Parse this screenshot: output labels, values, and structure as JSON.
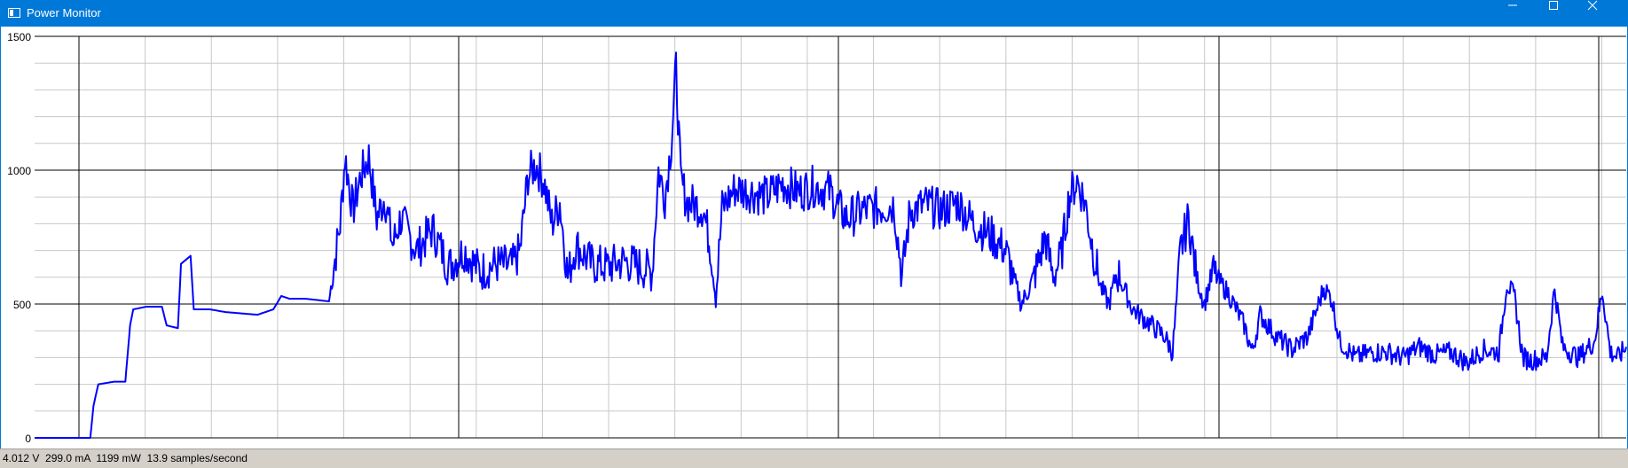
{
  "window": {
    "title": "Power Monitor",
    "minimize_icon": "minimize-icon",
    "maximize_icon": "maximize-icon",
    "close_icon": "close-icon",
    "accent_color": "#0078d7"
  },
  "status": {
    "text": "4.012 V  299.0 mA  1199 mW  13.9 samples/second"
  },
  "chart_data": {
    "type": "line",
    "title": "",
    "xlabel": "",
    "ylabel": "",
    "ylim": [
      0,
      1500
    ],
    "yticks": [
      0,
      500,
      1000,
      1500
    ],
    "grid": true,
    "line_color": "#0000ff",
    "x_range": [
      0,
      1000
    ],
    "series": [
      {
        "name": "",
        "points": [
          [
            0,
            0
          ],
          [
            30,
            0
          ],
          [
            35,
            0
          ],
          [
            37,
            120
          ],
          [
            40,
            200
          ],
          [
            50,
            210
          ],
          [
            57,
            210
          ],
          [
            60,
            420
          ],
          [
            62,
            480
          ],
          [
            70,
            490
          ],
          [
            80,
            490
          ],
          [
            83,
            420
          ],
          [
            90,
            410
          ],
          [
            92,
            650
          ],
          [
            98,
            680
          ],
          [
            100,
            480
          ],
          [
            110,
            480
          ],
          [
            120,
            470
          ],
          [
            140,
            460
          ],
          [
            150,
            480
          ],
          [
            155,
            530
          ],
          [
            160,
            520
          ],
          [
            170,
            520
          ],
          [
            185,
            510
          ],
          [
            188,
            640
          ],
          [
            192,
            800
          ],
          [
            195,
            1050
          ],
          [
            200,
            850
          ],
          [
            205,
            980
          ],
          [
            210,
            1050
          ],
          [
            215,
            820
          ],
          [
            220,
            900
          ],
          [
            225,
            720
          ],
          [
            230,
            820
          ],
          [
            240,
            700
          ],
          [
            250,
            780
          ],
          [
            260,
            640
          ],
          [
            270,
            700
          ],
          [
            280,
            620
          ],
          [
            290,
            650
          ],
          [
            300,
            640
          ],
          [
            305,
            700
          ],
          [
            310,
            980
          ],
          [
            315,
            1020
          ],
          [
            320,
            960
          ],
          [
            325,
            800
          ],
          [
            330,
            880
          ],
          [
            335,
            600
          ],
          [
            340,
            720
          ],
          [
            350,
            650
          ],
          [
            360,
            640
          ],
          [
            370,
            660
          ],
          [
            380,
            640
          ],
          [
            388,
            620
          ],
          [
            392,
            1000
          ],
          [
            396,
            900
          ],
          [
            400,
            1100
          ],
          [
            403,
            1380
          ],
          [
            406,
            960
          ],
          [
            410,
            880
          ],
          [
            420,
            860
          ],
          [
            425,
            700
          ],
          [
            428,
            520
          ],
          [
            432,
            860
          ],
          [
            440,
            930
          ],
          [
            450,
            920
          ],
          [
            460,
            900
          ],
          [
            470,
            950
          ],
          [
            480,
            920
          ],
          [
            490,
            940
          ],
          [
            500,
            920
          ],
          [
            505,
            860
          ],
          [
            510,
            820
          ],
          [
            520,
            850
          ],
          [
            530,
            860
          ],
          [
            540,
            870
          ],
          [
            545,
            600
          ],
          [
            550,
            850
          ],
          [
            560,
            870
          ],
          [
            570,
            850
          ],
          [
            580,
            880
          ],
          [
            590,
            800
          ],
          [
            600,
            760
          ],
          [
            610,
            700
          ],
          [
            615,
            600
          ],
          [
            620,
            500
          ],
          [
            625,
            560
          ],
          [
            630,
            640
          ],
          [
            635,
            750
          ],
          [
            640,
            600
          ],
          [
            645,
            680
          ],
          [
            650,
            900
          ],
          [
            655,
            960
          ],
          [
            660,
            880
          ],
          [
            665,
            700
          ],
          [
            670,
            560
          ],
          [
            675,
            500
          ],
          [
            680,
            620
          ],
          [
            690,
            480
          ],
          [
            700,
            430
          ],
          [
            710,
            380
          ],
          [
            715,
            320
          ],
          [
            720,
            700
          ],
          [
            725,
            820
          ],
          [
            730,
            600
          ],
          [
            735,
            500
          ],
          [
            740,
            620
          ],
          [
            750,
            540
          ],
          [
            760,
            420
          ],
          [
            765,
            320
          ],
          [
            770,
            460
          ],
          [
            780,
            380
          ],
          [
            790,
            330
          ],
          [
            800,
            380
          ],
          [
            810,
            560
          ],
          [
            815,
            520
          ],
          [
            820,
            360
          ],
          [
            830,
            300
          ],
          [
            840,
            320
          ],
          [
            850,
            320
          ],
          [
            860,
            300
          ],
          [
            870,
            340
          ],
          [
            880,
            310
          ],
          [
            890,
            320
          ],
          [
            900,
            280
          ],
          [
            910,
            330
          ],
          [
            920,
            320
          ],
          [
            925,
            580
          ],
          [
            930,
            520
          ],
          [
            935,
            300
          ],
          [
            940,
            290
          ],
          [
            950,
            300
          ],
          [
            955,
            560
          ],
          [
            960,
            340
          ],
          [
            970,
            300
          ],
          [
            980,
            360
          ],
          [
            985,
            550
          ],
          [
            990,
            320
          ],
          [
            995,
            300
          ],
          [
            1000,
            340
          ]
        ]
      }
    ]
  }
}
